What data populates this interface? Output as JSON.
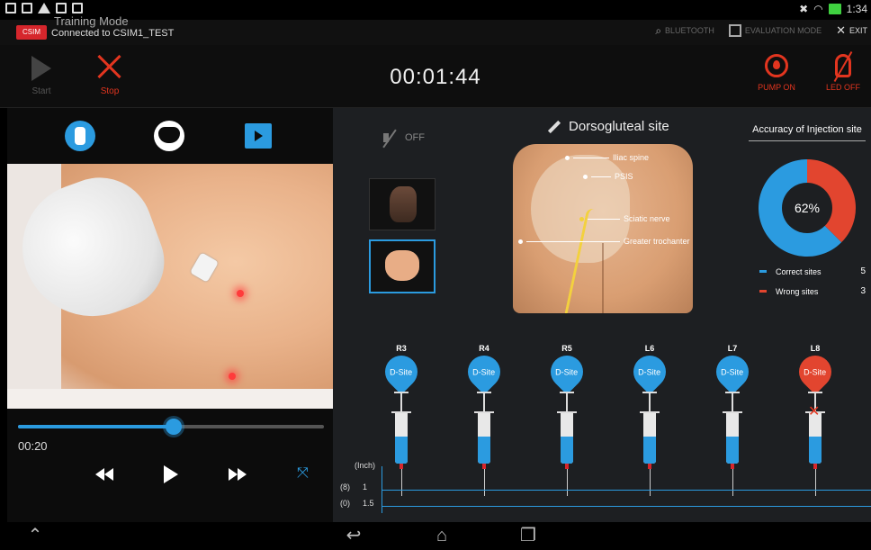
{
  "app": {
    "mode_title": "Training Mode",
    "badge": "CSIM",
    "connection": "Connected to CSIM1_TEST"
  },
  "status_bar": {
    "time": "1:34"
  },
  "header_actions": {
    "bluetooth": "BLUETOOTH",
    "evaluation": "EVALUATION MODE",
    "exit": "EXIT"
  },
  "controls": {
    "start_label": "Start",
    "stop_label": "Stop",
    "timer": "00:01:44",
    "pump_label": "PUMP ON",
    "led_label": "LED OFF"
  },
  "player": {
    "current_time": "00:20",
    "progress_fraction": 0.51
  },
  "sound": {
    "state": "OFF"
  },
  "site": {
    "title": "Dorsogluteal site",
    "labels": [
      "Iliac spine",
      "PSIS",
      "Sciatic nerve",
      "Greater trochanter"
    ]
  },
  "accuracy": {
    "title": "Accuracy of Injection site",
    "percent_text": "62%",
    "correct_label": "Correct sites",
    "correct_value": "5",
    "wrong_label": "Wrong sites",
    "wrong_value": "3",
    "correct_color": "#2b9be0",
    "wrong_color": "#e2452f"
  },
  "injections": [
    {
      "pos": "R3",
      "site": "D-Site",
      "status": "correct"
    },
    {
      "pos": "R4",
      "site": "D-Site",
      "status": "correct"
    },
    {
      "pos": "R5",
      "site": "D-Site",
      "status": "correct"
    },
    {
      "pos": "L6",
      "site": "D-Site",
      "status": "correct"
    },
    {
      "pos": "L7",
      "site": "D-Site",
      "status": "correct"
    },
    {
      "pos": "L8",
      "site": "D-Site",
      "status": "wrong"
    }
  ],
  "depth": {
    "unit": "(Inch)",
    "row1_left": "(8)",
    "row1_right": "1",
    "row2_left": "(0)",
    "row2_right": "1.5"
  }
}
